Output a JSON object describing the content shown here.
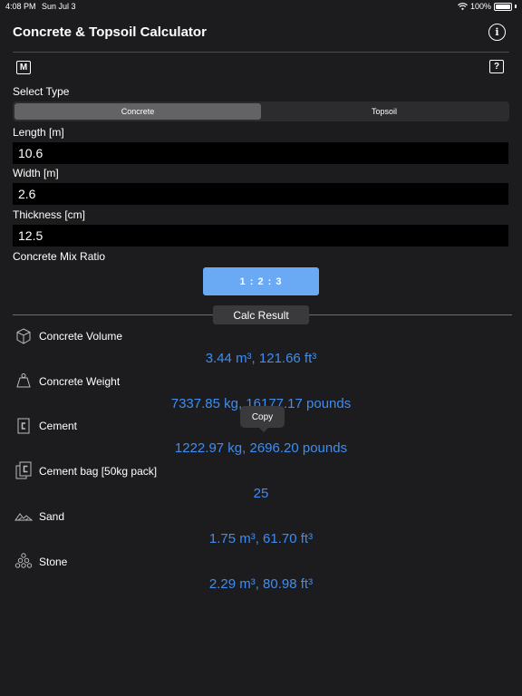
{
  "status_bar": {
    "time": "4:08 PM",
    "date": "Sun Jul 3",
    "battery": "100%"
  },
  "header": {
    "title": "Concrete & Topsoil Calculator",
    "m_label": "M",
    "help_label": "?",
    "info_label": "i"
  },
  "select_type": {
    "label": "Select Type",
    "options": [
      "Concrete",
      "Topsoil"
    ],
    "selected": "Concrete"
  },
  "inputs": {
    "length": {
      "label": "Length [m]",
      "value": "10.6"
    },
    "width": {
      "label": "Width [m]",
      "value": "2.6"
    },
    "thickness": {
      "label": "Thickness [cm]",
      "value": "12.5"
    }
  },
  "mix_ratio": {
    "label": "Concrete Mix Ratio",
    "value": "1 : 2 : 3"
  },
  "calc_result_label": "Calc Result",
  "results": [
    {
      "label": "Concrete Volume",
      "icon": "cube-icon",
      "value": "3.44 m³, 121.66 ft³"
    },
    {
      "label": "Concrete Weight",
      "icon": "weight-icon",
      "value": "7337.85 kg, 16177.17 pounds"
    },
    {
      "label": "Cement",
      "icon": "cement-icon",
      "value": "1222.97 kg, 2696.20 pounds"
    },
    {
      "label": "Cement bag [50kg pack]",
      "icon": "cement-bags-icon",
      "value": "25"
    },
    {
      "label": "Sand",
      "icon": "sand-icon",
      "value": "1.75 m³, 61.70 ft³"
    },
    {
      "label": "Stone",
      "icon": "stone-icon",
      "value": "2.29 m³, 80.98 ft³"
    }
  ],
  "tooltip": {
    "label": "Copy"
  },
  "colors": {
    "background": "#1c1c1e",
    "accent": "#3f8df0",
    "button": "#6aaaf5",
    "segment_active": "#636366"
  }
}
